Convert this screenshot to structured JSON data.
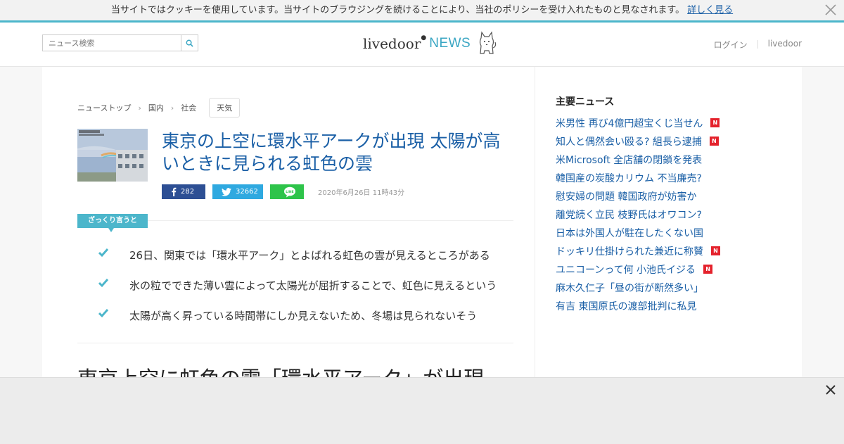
{
  "cookie": {
    "text": "当サイトではクッキーを使用しています。当サイトのブラウジングを続けることにより、当社のポリシーを受け入れたものと見なされます。",
    "link": "詳しく見る"
  },
  "header": {
    "search_placeholder": "ニュース検索",
    "logo_livedoor": "livedoor",
    "logo_news": "NEWS",
    "login": "ログイン",
    "livedoor": "livedoor"
  },
  "breadcrumb": [
    "ニューストップ",
    "国内",
    "社会"
  ],
  "tag": "天気",
  "article": {
    "title": "東京の上空に環水平アークが出現 太陽が高いときに見られる虹色の雲",
    "facebook_count": "282",
    "twitter_count": "32662",
    "date": "2020年6月26日 11時43分",
    "zakkuri_label": "ざっくり言うと",
    "points": [
      "26日、関東では「環水平アーク」とよばれる虹色の雲が見えるところがある",
      "氷の粒でできた薄い雲によって太陽光が屈折することで、虹色に見えるという",
      "太陽が高く昇っている時間帯にしか見えないため、冬場は見られないそう"
    ],
    "body_heading": "東京上空に虹色の雲「環水平アーク」が出現"
  },
  "sidebar": {
    "title": "主要ニュース",
    "items": [
      {
        "label": "米男性 再び4億円超宝くじ当せん",
        "new": true
      },
      {
        "label": "知人と偶然会い殴る? 組長ら逮捕",
        "new": true
      },
      {
        "label": "米Microsoft 全店舗の閉鎖を発表",
        "new": false
      },
      {
        "label": "韓国産の炭酸カリウム 不当廉売?",
        "new": false
      },
      {
        "label": "慰安婦の問題 韓国政府が妨害か",
        "new": false
      },
      {
        "label": "離党続く立民 枝野氏はオワコン?",
        "new": false
      },
      {
        "label": "日本は外国人が駐在したくない国",
        "new": false
      },
      {
        "label": "ドッキリ仕掛けられた兼近に称賛",
        "new": true
      },
      {
        "label": "ユニコーンって何 小池氏イジる",
        "new": true
      },
      {
        "label": "麻木久仁子「昼の街が断然多い」",
        "new": false
      },
      {
        "label": "有吉 東国原氏の渡部批判に私見",
        "new": false
      }
    ],
    "new_badge": "N"
  },
  "colors": {
    "accent": "#4cb6cb",
    "link": "#1a5fa6",
    "facebook": "#2d4f94",
    "twitter": "#2fa9e0",
    "line": "#2ec44a",
    "new_badge": "#e4222c"
  }
}
